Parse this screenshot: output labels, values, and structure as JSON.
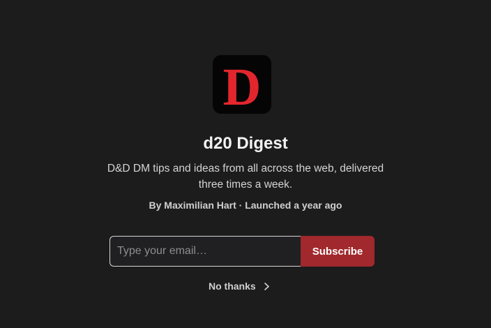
{
  "publication": {
    "logo_letter": "D",
    "title": "d20 Digest",
    "description": "D&D DM tips and ideas from all across the web, delivered three times a week.",
    "byline": "By Maximilian Hart · Launched a year ago"
  },
  "subscribe_form": {
    "email_placeholder": "Type your email…",
    "email_value": "",
    "subscribe_label": "Subscribe"
  },
  "dismiss": {
    "label": "No thanks",
    "icon": "chevron-right-icon"
  },
  "colors": {
    "background": "#1c1c1d",
    "accent": "#a1282c",
    "logo_letter": "#e3262d",
    "logo_background": "#050505"
  }
}
